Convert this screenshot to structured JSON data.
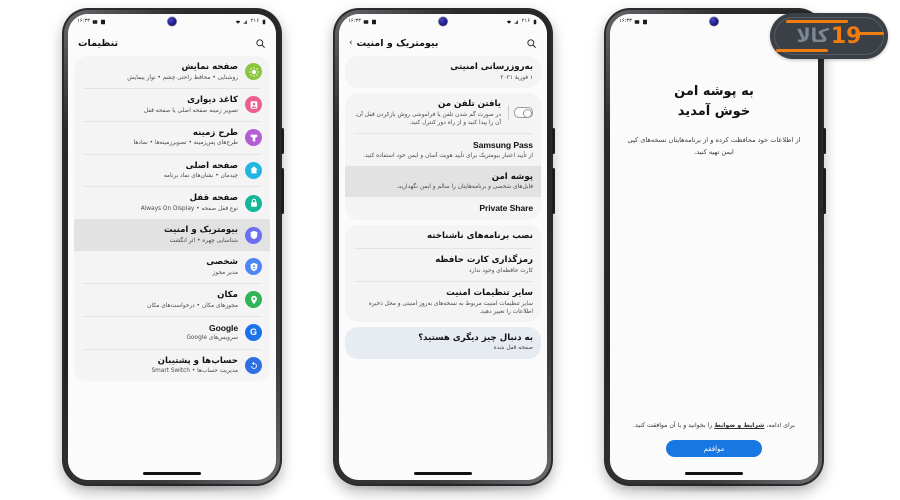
{
  "watermark": {
    "brand_latin": "19",
    "brand_fa": "کالا",
    "accent": "#f07d12",
    "bg": "#3b4047"
  },
  "status_bar": {
    "left_text": "۲۱۶",
    "time": "۱۶:۳۳",
    "icons_left": [
      "battery-icon",
      "signal-icon",
      "wifi-icon"
    ],
    "icons_right": [
      "sim-icon",
      "gallery-icon"
    ]
  },
  "phone1": {
    "header": {
      "title": "تنظیمات",
      "search_icon": "search-icon"
    },
    "items": [
      {
        "title": "صفحه نمایش",
        "subtitle": "روشنایی • محافظ راحتی چشم • نوار پیمایش",
        "icon": "brightness-icon",
        "color": "#8cc63e",
        "selected": false
      },
      {
        "title": "کاغذ دیواری",
        "subtitle": "تصویر زمینه صفحه اصلی یا صفحه قفل",
        "icon": "wallpaper-icon",
        "color": "#ec5e8c",
        "selected": false
      },
      {
        "title": "طرح زمینه",
        "subtitle": "طرح‌های پس‌زمینه • تصویرزمینه‌ها • نمادها",
        "icon": "theme-icon",
        "color": "#b45ed6",
        "selected": false
      },
      {
        "title": "صفحه اصلی",
        "subtitle": "چیدمان • نشان‌های نماد برنامه",
        "icon": "home-icon",
        "color": "#22b6e0",
        "selected": false
      },
      {
        "title": "صفحه قفل",
        "subtitle": "نوع قفل صفحه • Always On Display",
        "icon": "lock-icon",
        "color": "#14b79a",
        "selected": false
      },
      {
        "title": "بیومتریک و امنیت",
        "subtitle": "شناسایی چهره • اثر انگشت",
        "icon": "shield-icon",
        "color": "#6b6ff0",
        "selected": true
      },
      {
        "title": "شخصی",
        "subtitle": "مدیر مجوز",
        "icon": "privacy-icon",
        "color": "#4f86f7",
        "selected": false
      },
      {
        "title": "مکان",
        "subtitle": "مجوزهای مکان • درخواست‌های مکان",
        "icon": "location-icon",
        "color": "#2fb457",
        "selected": false
      },
      {
        "title": "Google",
        "subtitle": "سرویس‌های Google",
        "icon": "google-icon",
        "color": "#1a73e8",
        "selected": false,
        "latin": true
      },
      {
        "title": "حساب‌ها و پشتیبان",
        "subtitle": "مدیریت حساب‌ها • Smart Switch",
        "icon": "sync-icon",
        "color": "#2f6fe0",
        "selected": false
      }
    ]
  },
  "phone2": {
    "header": {
      "title": "بیومتریک و امنیت",
      "back_icon": "chevron-back-icon",
      "search_icon": "search-icon"
    },
    "groups": [
      {
        "items": [
          {
            "title": "به‌روزرسانی امنیتی",
            "subtitle": "۱ فوریهٔ ۲۰۲۱",
            "selected": false
          }
        ]
      },
      {
        "items": [
          {
            "title": "یافتن تلفن من",
            "subtitle": "در صورت گم شدن تلفن یا فراموشی روش بازکردن قفل آن، آن را پیدا کنید و از راه دور کنترل کنید.",
            "toggle": "off",
            "selected": false
          },
          {
            "title": "Samsung Pass",
            "subtitle": "از تأیید اعتبار بیومتریک برای تأیید هویت آسان و ایمن خود استفاده کنید.",
            "selected": false,
            "latin": true
          },
          {
            "title": "پوشه امن",
            "subtitle": "فایل‌های شخصی و برنامه‌هایتان را سالم و ایمن نگهدارید.",
            "selected": true
          },
          {
            "title": "Private Share",
            "subtitle": "",
            "selected": false,
            "latin": true
          }
        ]
      },
      {
        "items": [
          {
            "title": "نصب برنامه‌های ناشناخته",
            "subtitle": "",
            "selected": false
          },
          {
            "title": "رمزگذاری کارت حافظه",
            "subtitle": "کارت حافظه‌ای وجود ندارد",
            "selected": false
          },
          {
            "title": "سایر تنظیمات امنیت",
            "subtitle": "سایر تنظیمات امنیت مربوط به نسخه‌های به‌روز امنیتی و محل ذخیره اطلاعات را تغییر دهید.",
            "selected": false
          }
        ]
      },
      {
        "items": [
          {
            "title": "به دنبال چیز دیگری هستید؟",
            "subtitle": "صفحه قفل شده",
            "selected": false,
            "highlight": true
          }
        ]
      }
    ]
  },
  "phone3": {
    "title_line1": "به پوشه امن",
    "title_line2": "خوش آمدید",
    "subtitle": "از اطلاعات خود محافظت کرده و از برنامه‌هایتان نسخه‌های کپی ایمن تهیه کنید.",
    "terms_prefix": "برای ادامه، ",
    "terms_link": "شرایط و ضوابط",
    "terms_suffix": " را بخوانید و با آن موافقت کنید.",
    "agree_label": "موافقم",
    "agree_color": "#1877e0"
  }
}
